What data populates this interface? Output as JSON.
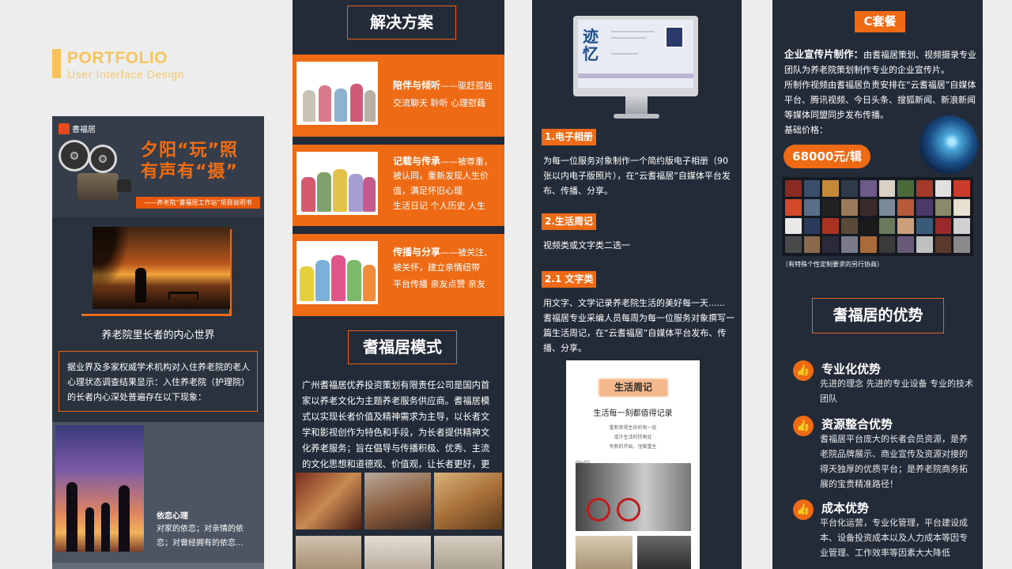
{
  "portfolio": {
    "title": "PORTFOLIO",
    "subtitle": "User Interface Design"
  },
  "col1": {
    "logo": "書福居",
    "headline_line1": "夕阳“玩”照",
    "headline_line2": "有声有“摄”",
    "tag": "——养老院“書福居工作站”项目说明书",
    "caption": "养老院里长者的内心世界",
    "box_text": "据业界及多家权威学术机构对入住养老院的老人心理状态调查结果显示：入住养老院（护理院）的长者内心深处普遍存在以下现象：",
    "sub_heading": "依恋心理",
    "sub_text": "对家的依恋；对亲情的依恋；对曾经拥有的依恋..."
  },
  "col2": {
    "title_solution": "解决方案",
    "features": [
      {
        "title": "陪伴与倾听",
        "suffix": "——驱赶孤独",
        "text": "交流聊天  聆听  心理慰藉"
      },
      {
        "title": "记载与传承",
        "suffix": "——被尊重，",
        "text": "被认同，重新发现人生价值，满足怀旧心理\n生活日记  个人历史  人生"
      },
      {
        "title": "传播与分享",
        "suffix": "——被关注、",
        "text": "被关怀，建立亲情纽带\n平台传播  亲友点赞  亲友"
      }
    ],
    "title_model": "耆福居模式",
    "model_text": "广州耆福居优养投资策划有限责任公司是国内首家以养老文化为主题养老服务供应商。耆福居模式以实现长者价值及精神需求为主导，以长者文学和影视创作为特色和手段，为长者提供精神文化养老服务；旨在倡导与传播积极、优秀、主流的文化思想和道德观、价值观，让长者更好，更快乐！"
  },
  "col3": {
    "screen_title": "迹忆",
    "tag1": "1.电子相册",
    "text1": "为每一位服务对象制作一个简约版电子相册（90张以内电子版照片），在“云耆福居”自媒体平台发布、传播、分享。",
    "tag2": "2.生活周记",
    "text2": "视频类或文字类二选一",
    "tag3": "2.1 文字类",
    "text3": "用文字、文学记录养老院生活的美好每一天......\n耆福居专业采编人员每周为每一位服务对象撰写一篇生活周记，在“云耆福居”自媒体平台发布、传播、分享。",
    "paper_tag": "生活周记",
    "paper_heading": "生活每一刻都值得记录",
    "paper_line1": "重新审视生命的每一处",
    "paper_line2": "或许生活的拐角处",
    "paper_line3": "有新的开始，涅槃重生",
    "paper_day": "day01"
  },
  "col4": {
    "tag": "C套餐",
    "lead_bold": "企业宣传片制作：",
    "lead_text": "由耆福居策划、视频摄录专业团队为养老院策划制作专业的企业宣传片。",
    "text2": "所制作视频由耆福居负责安排在“云耆福居”自媒体平台、腾讯视频、今日头条、搜狐新闻、新浪新闻等媒体同盟同步发布传播。",
    "price_label": "基础价格：",
    "price": "68000元/辑",
    "note": "（有特殊个性定制要求的另行协商）",
    "title_adv": "耆福居的优势",
    "advantages": [
      {
        "title": "专业化优势",
        "text": "先进的理念  先进的专业设备  专业的技术团队"
      },
      {
        "title": "资源整合优势",
        "text": "耆福居平台庞大的长者会员资源，是养老院品牌展示、商业宣传及资源对接的得天独厚的优质平台；是养老院商务拓展的宝贵精准路径！"
      },
      {
        "title": "成本优势",
        "text": "平台化运营，专业化管理，平台建设成本、设备投资成本以及人力成本等因专业管理、工作效率等因素大大降低"
      }
    ]
  },
  "colors": {
    "accent": "#ef6a14",
    "panel": "#232b38",
    "portfolio_yellow": "#f6c55d"
  }
}
